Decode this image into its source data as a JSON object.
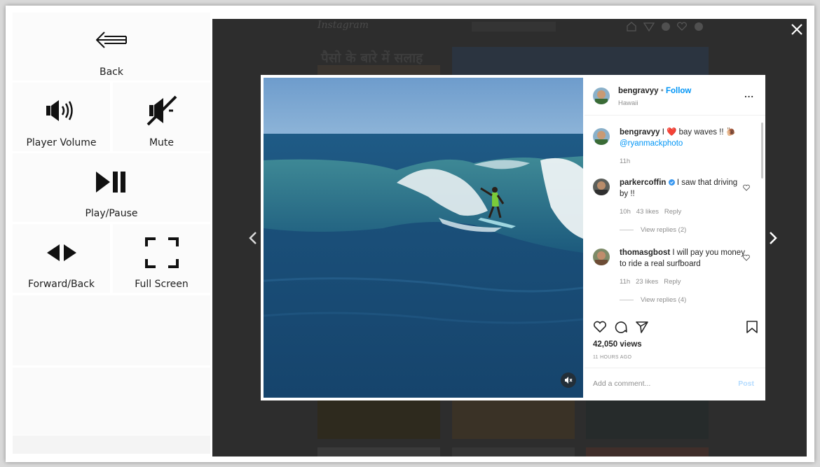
{
  "controls": {
    "back": "Back",
    "player_volume": "Player Volume",
    "mute": "Mute",
    "play_pause": "Play/Pause",
    "forward_back": "Forward/Back",
    "full_screen": "Full Screen"
  },
  "background": {
    "logo": "Instagram",
    "heading": "पैसो के बारे में सलाह"
  },
  "post": {
    "username": "bengravyy",
    "follow": "Follow",
    "location": "Hawaii",
    "more": "...",
    "caption_user": "bengravyy",
    "caption_text": " I ❤️ bay waves !! 🐌",
    "caption_mention": "@ryanmackphoto",
    "caption_time": "11h",
    "comments": [
      {
        "user": "parkercoffin",
        "text": " I saw that driving by !!",
        "time": "10h",
        "likes": "43 likes",
        "reply": "Reply",
        "view_replies": "View replies (2)"
      },
      {
        "user": "thomasgbost",
        "text": " I will pay you money to ride a real surfboard",
        "time": "11h",
        "likes": "23 likes",
        "reply": "Reply",
        "view_replies": "View replies (4)"
      }
    ],
    "views": "42,050 views",
    "time_ago": "11 HOURS AGO",
    "add_comment_placeholder": "Add a comment...",
    "post_button": "Post"
  },
  "colors": {
    "overlay": "#2d2d2d",
    "link": "#0095f6",
    "heart": "#ed4956"
  }
}
